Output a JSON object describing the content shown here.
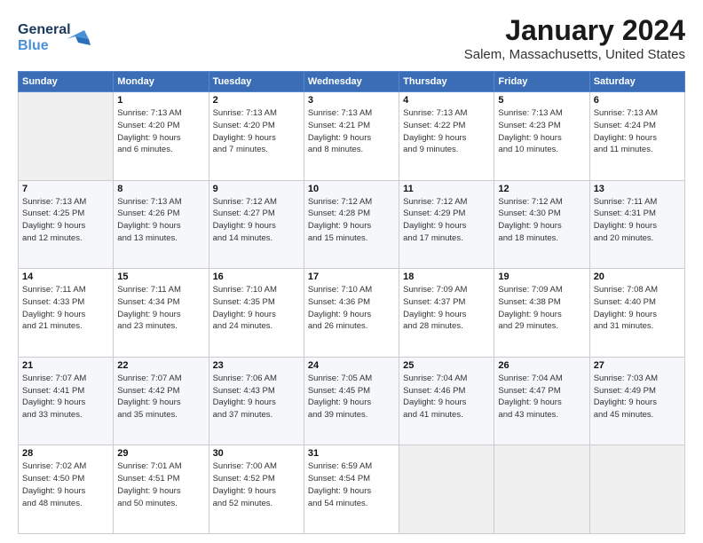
{
  "logo": {
    "line1": "General",
    "line2": "Blue"
  },
  "title": "January 2024",
  "subtitle": "Salem, Massachusetts, United States",
  "days_header": [
    "Sunday",
    "Monday",
    "Tuesday",
    "Wednesday",
    "Thursday",
    "Friday",
    "Saturday"
  ],
  "weeks": [
    [
      {
        "num": "",
        "info": ""
      },
      {
        "num": "1",
        "info": "Sunrise: 7:13 AM\nSunset: 4:20 PM\nDaylight: 9 hours\nand 6 minutes."
      },
      {
        "num": "2",
        "info": "Sunrise: 7:13 AM\nSunset: 4:20 PM\nDaylight: 9 hours\nand 7 minutes."
      },
      {
        "num": "3",
        "info": "Sunrise: 7:13 AM\nSunset: 4:21 PM\nDaylight: 9 hours\nand 8 minutes."
      },
      {
        "num": "4",
        "info": "Sunrise: 7:13 AM\nSunset: 4:22 PM\nDaylight: 9 hours\nand 9 minutes."
      },
      {
        "num": "5",
        "info": "Sunrise: 7:13 AM\nSunset: 4:23 PM\nDaylight: 9 hours\nand 10 minutes."
      },
      {
        "num": "6",
        "info": "Sunrise: 7:13 AM\nSunset: 4:24 PM\nDaylight: 9 hours\nand 11 minutes."
      }
    ],
    [
      {
        "num": "7",
        "info": "Sunrise: 7:13 AM\nSunset: 4:25 PM\nDaylight: 9 hours\nand 12 minutes."
      },
      {
        "num": "8",
        "info": "Sunrise: 7:13 AM\nSunset: 4:26 PM\nDaylight: 9 hours\nand 13 minutes."
      },
      {
        "num": "9",
        "info": "Sunrise: 7:12 AM\nSunset: 4:27 PM\nDaylight: 9 hours\nand 14 minutes."
      },
      {
        "num": "10",
        "info": "Sunrise: 7:12 AM\nSunset: 4:28 PM\nDaylight: 9 hours\nand 15 minutes."
      },
      {
        "num": "11",
        "info": "Sunrise: 7:12 AM\nSunset: 4:29 PM\nDaylight: 9 hours\nand 17 minutes."
      },
      {
        "num": "12",
        "info": "Sunrise: 7:12 AM\nSunset: 4:30 PM\nDaylight: 9 hours\nand 18 minutes."
      },
      {
        "num": "13",
        "info": "Sunrise: 7:11 AM\nSunset: 4:31 PM\nDaylight: 9 hours\nand 20 minutes."
      }
    ],
    [
      {
        "num": "14",
        "info": "Sunrise: 7:11 AM\nSunset: 4:33 PM\nDaylight: 9 hours\nand 21 minutes."
      },
      {
        "num": "15",
        "info": "Sunrise: 7:11 AM\nSunset: 4:34 PM\nDaylight: 9 hours\nand 23 minutes."
      },
      {
        "num": "16",
        "info": "Sunrise: 7:10 AM\nSunset: 4:35 PM\nDaylight: 9 hours\nand 24 minutes."
      },
      {
        "num": "17",
        "info": "Sunrise: 7:10 AM\nSunset: 4:36 PM\nDaylight: 9 hours\nand 26 minutes."
      },
      {
        "num": "18",
        "info": "Sunrise: 7:09 AM\nSunset: 4:37 PM\nDaylight: 9 hours\nand 28 minutes."
      },
      {
        "num": "19",
        "info": "Sunrise: 7:09 AM\nSunset: 4:38 PM\nDaylight: 9 hours\nand 29 minutes."
      },
      {
        "num": "20",
        "info": "Sunrise: 7:08 AM\nSunset: 4:40 PM\nDaylight: 9 hours\nand 31 minutes."
      }
    ],
    [
      {
        "num": "21",
        "info": "Sunrise: 7:07 AM\nSunset: 4:41 PM\nDaylight: 9 hours\nand 33 minutes."
      },
      {
        "num": "22",
        "info": "Sunrise: 7:07 AM\nSunset: 4:42 PM\nDaylight: 9 hours\nand 35 minutes."
      },
      {
        "num": "23",
        "info": "Sunrise: 7:06 AM\nSunset: 4:43 PM\nDaylight: 9 hours\nand 37 minutes."
      },
      {
        "num": "24",
        "info": "Sunrise: 7:05 AM\nSunset: 4:45 PM\nDaylight: 9 hours\nand 39 minutes."
      },
      {
        "num": "25",
        "info": "Sunrise: 7:04 AM\nSunset: 4:46 PM\nDaylight: 9 hours\nand 41 minutes."
      },
      {
        "num": "26",
        "info": "Sunrise: 7:04 AM\nSunset: 4:47 PM\nDaylight: 9 hours\nand 43 minutes."
      },
      {
        "num": "27",
        "info": "Sunrise: 7:03 AM\nSunset: 4:49 PM\nDaylight: 9 hours\nand 45 minutes."
      }
    ],
    [
      {
        "num": "28",
        "info": "Sunrise: 7:02 AM\nSunset: 4:50 PM\nDaylight: 9 hours\nand 48 minutes."
      },
      {
        "num": "29",
        "info": "Sunrise: 7:01 AM\nSunset: 4:51 PM\nDaylight: 9 hours\nand 50 minutes."
      },
      {
        "num": "30",
        "info": "Sunrise: 7:00 AM\nSunset: 4:52 PM\nDaylight: 9 hours\nand 52 minutes."
      },
      {
        "num": "31",
        "info": "Sunrise: 6:59 AM\nSunset: 4:54 PM\nDaylight: 9 hours\nand 54 minutes."
      },
      {
        "num": "",
        "info": ""
      },
      {
        "num": "",
        "info": ""
      },
      {
        "num": "",
        "info": ""
      }
    ]
  ]
}
